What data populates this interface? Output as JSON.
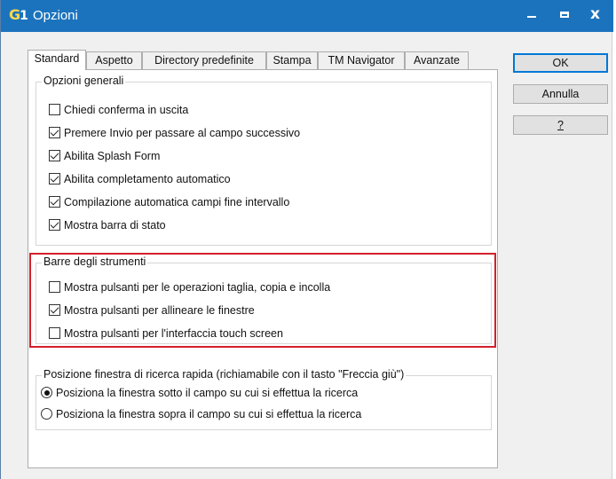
{
  "window": {
    "title": "Opzioni",
    "icon_glyph": "G",
    "icon_sub": "1",
    "titlebar_color": "#1b73bd",
    "minimize_icon": "minimize-icon",
    "maximize_icon": "maximize-icon",
    "close_icon": "close-icon",
    "close_glyph": "x"
  },
  "tabs": [
    {
      "label": "Standard",
      "active": true
    },
    {
      "label": "Aspetto",
      "active": false
    },
    {
      "label": "Directory predefinite",
      "active": false
    },
    {
      "label": "Stampa",
      "active": false
    },
    {
      "label": "TM Navigator",
      "active": false
    },
    {
      "label": "Avanzate",
      "active": false
    }
  ],
  "groups": {
    "general": {
      "title": "Opzioni generali",
      "options": [
        {
          "label": "Chiedi conferma in uscita",
          "checked": false
        },
        {
          "label": "Premere Invio per passare al campo successivo",
          "checked": true
        },
        {
          "label": "Abilita Splash Form",
          "checked": true
        },
        {
          "label": "Abilita completamento automatico",
          "checked": true
        },
        {
          "label": "Compilazione automatica campi fine intervallo",
          "checked": true
        },
        {
          "label": "Mostra barra di stato",
          "checked": true
        }
      ]
    },
    "toolbars": {
      "title": "Barre degli strumenti",
      "highlight_color": "#d41f2b",
      "options": [
        {
          "label": "Mostra pulsanti per le operazioni taglia, copia e incolla",
          "checked": false
        },
        {
          "label": "Mostra pulsanti per allineare le finestre",
          "checked": true
        },
        {
          "label": "Mostra pulsanti per l'interfaccia touch screen",
          "checked": false
        }
      ]
    },
    "search_window": {
      "title": "Posizione finestra di ricerca rapida (richiamabile con il tasto \"Freccia giù\")",
      "options": [
        {
          "label": "Posiziona la finestra sotto il campo su cui si effettua la ricerca",
          "selected": true
        },
        {
          "label": "Posiziona la finestra sopra il campo su cui si effettua la ricerca",
          "selected": false
        }
      ]
    }
  },
  "buttons": {
    "ok": "OK",
    "cancel": "Annulla",
    "help": "?"
  }
}
